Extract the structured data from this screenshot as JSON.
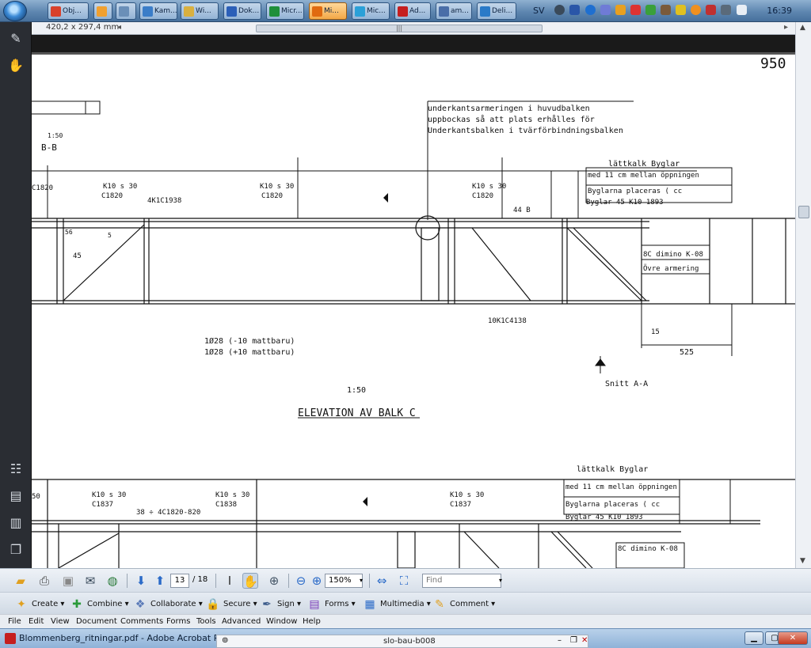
{
  "taskbar": {
    "buttons": [
      {
        "label": "Obj...",
        "color": "#d9412b"
      },
      {
        "label": "",
        "color": "#f0a030"
      },
      {
        "label": "",
        "color": "#6a8fb8"
      },
      {
        "label": "Kam...",
        "color": "#3b7dc8"
      },
      {
        "label": "Wi...",
        "color": "#d9b040"
      },
      {
        "label": "Dok...",
        "color": "#2b5fb8"
      },
      {
        "label": "Micr...",
        "color": "#1f8f3a"
      },
      {
        "label": "Mi...",
        "color": "#e06a10"
      },
      {
        "label": "Mic...",
        "color": "#2aa0d8"
      },
      {
        "label": "Ad...",
        "color": "#c51f1f"
      },
      {
        "label": "am...",
        "color": "#4a6ea8"
      },
      {
        "label": "Deli...",
        "color": "#2a7ac8"
      }
    ],
    "lang": "SV",
    "clock": "16:39"
  },
  "ruler": {
    "page_size": "420,2 x 297,4 mm"
  },
  "drawing": {
    "texts": {
      "corner_number": "950",
      "note_line1": "underkantsarmeringen i huvudbalken",
      "note_line2": "uppbockas så att plats erhålles för",
      "note_line3": "Underkantsbalken i tvärförbindningsbalken",
      "section_ref": "B-B",
      "scale_top": "1:50",
      "k_left": "K10 s 30",
      "c_left": "C1820",
      "k_mid": "K10 s 30",
      "c_mid": "C1820",
      "k_mid2": "K10 s 30",
      "c_mid2": "C1820",
      "bar_label": "4K1C1938",
      "dim_44": "44 B",
      "beam_note_1": "lättkalk Byglar",
      "beam_note_2": "Byglarna placeras ( cc",
      "beam_note_3": "med 11 cm mellan öppningen",
      "beam_note_4": "Byglar 45 K10 1893",
      "armering_1": "Övre armering",
      "armering_2": "8C dimino K-08",
      "bottom_bar": "10K1C4138",
      "dim_15": "15",
      "dim_525": "525",
      "elev_note_1": "1Ø28 (-10 mattbaru)",
      "elev_note_2": "1Ø28 (+10 mattbaru)",
      "scale_mid": "1:50",
      "elevation_title": "ELEVATION AV BALK C",
      "snitt": "Snitt A-A",
      "lower_k1": "K10 s 30",
      "lower_k2": "K10 s 30",
      "lower_k3": "K10 s 30",
      "lower_c1": "C1837",
      "lower_c2": "C1838",
      "lower_c3": "C1837",
      "lower_bar": "38 ÷ 4C1820-820",
      "lower_note": "lättkalk Byglar",
      "lower_note2": "med 11 cm mellan öppningen",
      "lower_note3": "Byglarna placeras ( cc",
      "lower_note4": "Byglar 45 K10 1893",
      "lower_arm": "8C dimino K-08"
    }
  },
  "toolbar": {
    "page_current": "13",
    "page_total": "/ 18",
    "zoom": "150%",
    "find_placeholder": "Find"
  },
  "tasks": [
    {
      "label": "Create",
      "icon": "create-icon"
    },
    {
      "label": "Combine",
      "icon": "combine-icon"
    },
    {
      "label": "Collaborate",
      "icon": "collaborate-icon"
    },
    {
      "label": "Secure",
      "icon": "secure-icon"
    },
    {
      "label": "Sign",
      "icon": "sign-icon"
    },
    {
      "label": "Forms",
      "icon": "forms-icon"
    },
    {
      "label": "Multimedia",
      "icon": "multimedia-icon"
    },
    {
      "label": "Comment",
      "icon": "comment-icon"
    }
  ],
  "menu": [
    "File",
    "Edit",
    "View",
    "Document",
    "Comments",
    "Forms",
    "Tools",
    "Advanced",
    "Window",
    "Help"
  ],
  "window": {
    "title": "Blommenberg_ritningar.pdf - Adobe Acrobat Pro",
    "inner_title": "slo-bau-b008"
  }
}
